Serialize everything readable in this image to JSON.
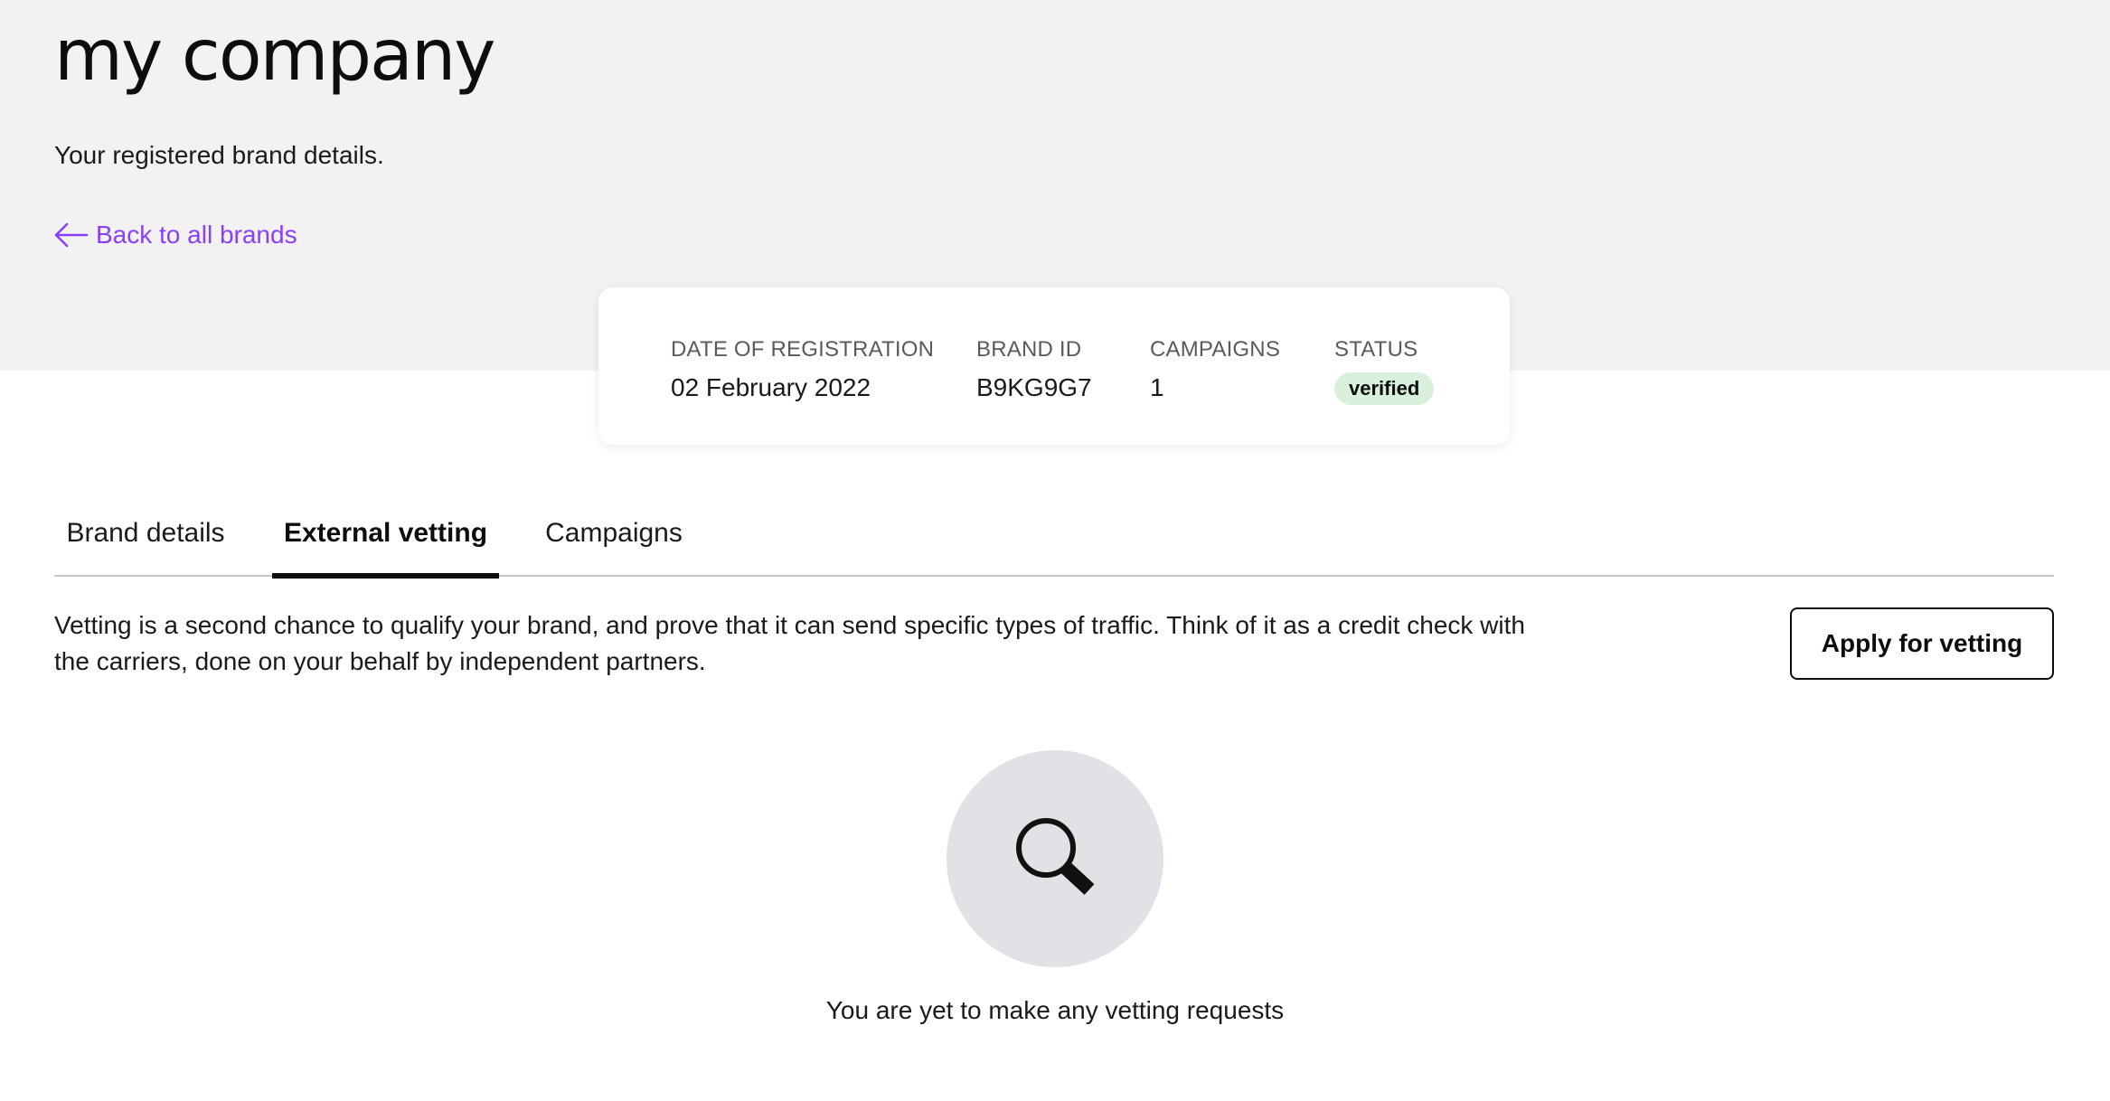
{
  "header": {
    "title": "my company",
    "subtitle": "Your registered brand details.",
    "back_link": "Back to all brands"
  },
  "summary": {
    "registration_label": "DATE OF REGISTRATION",
    "registration_value": "02 February 2022",
    "brand_id_label": "BRAND ID",
    "brand_id_value": "B9KG9G7",
    "campaigns_label": "CAMPAIGNS",
    "campaigns_value": "1",
    "status_label": "STATUS",
    "status_value": "verified"
  },
  "tabs": [
    {
      "label": "Brand details",
      "active": false
    },
    {
      "label": "External vetting",
      "active": true
    },
    {
      "label": "Campaigns",
      "active": false
    }
  ],
  "vetting": {
    "description": "Vetting is a second chance to qualify your brand, and prove that it can send specific types of traffic. Think of it as a credit check with the carriers, done on your behalf by independent partners.",
    "apply_button": "Apply for vetting",
    "empty_icon": "search-icon",
    "empty_message": "You are yet to make any vetting requests"
  },
  "colors": {
    "accent": "#8a3ffc",
    "hero_background": "#f2f2f2",
    "status_badge": "#d8f0dc",
    "empty_circle": "#e1e2e6"
  }
}
